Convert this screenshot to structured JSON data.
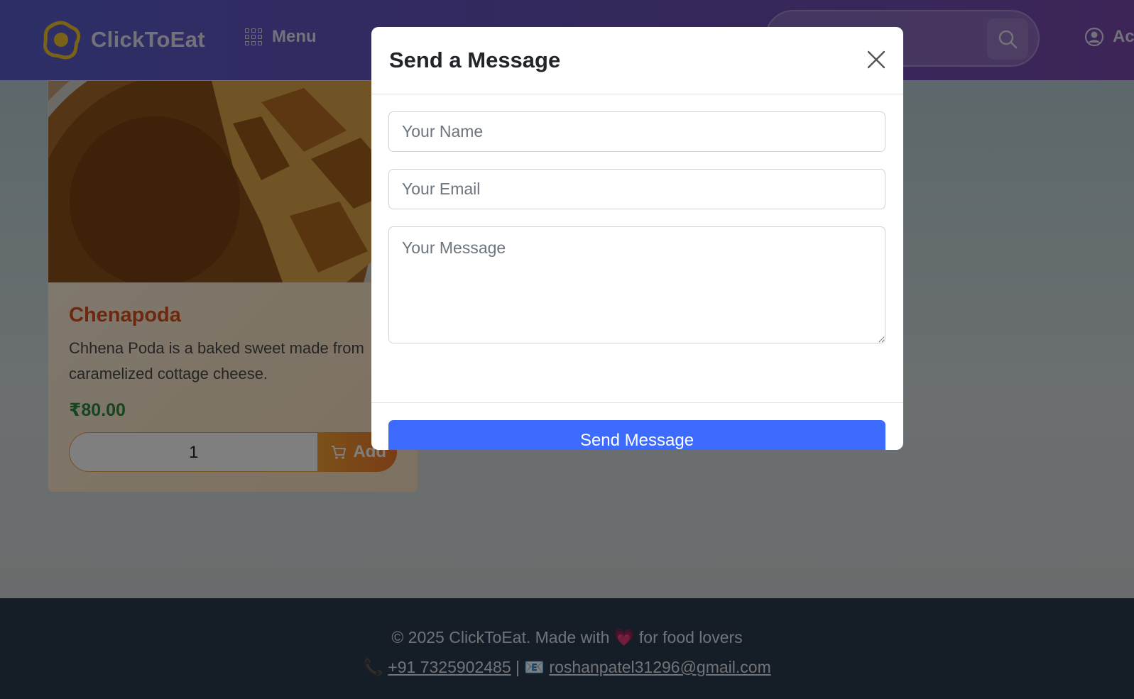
{
  "navbar": {
    "brand": "ClickToEat",
    "menu_label": "Menu",
    "account_label": "Ac"
  },
  "card": {
    "title": "Chenapoda",
    "description": "Chhena Poda is a baked sweet made from caramelized cottage cheese.",
    "price": "₹80.00",
    "quantity": "1",
    "add_label": "Add"
  },
  "footer": {
    "copyright_prefix": "© 2025 ClickToEat. Made with",
    "heart": "💗",
    "copyright_suffix": "for food lovers",
    "phone_icon": "📞",
    "phone": "+91 7325902485",
    "separator": "|",
    "email_icon": "📧",
    "email": "roshanpatel31296@gmail.com"
  },
  "modal": {
    "title": "Send a Message",
    "name_placeholder": "Your Name",
    "email_placeholder": "Your Email",
    "message_placeholder": "Your Message",
    "send_label": "Send Message"
  },
  "colors": {
    "primary": "#3d6bfd",
    "navbar": "#5a5fcf",
    "food_title": "#d9531e",
    "price": "#2e8b3e",
    "add_button": "#f7a233",
    "footer": "#2b3a4c"
  }
}
